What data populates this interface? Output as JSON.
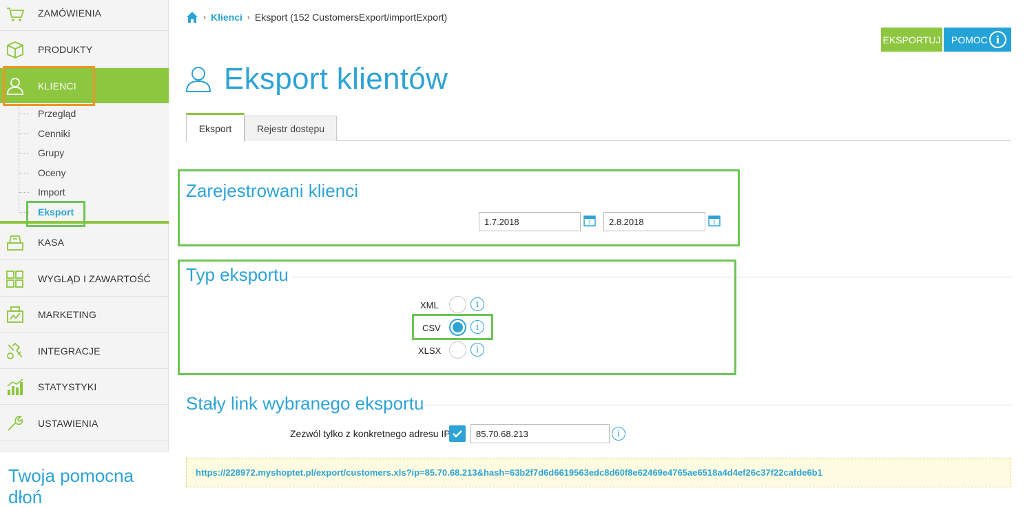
{
  "sidebar": {
    "nav": [
      {
        "label": "ZAMÓWIENIA",
        "icon": "cart-icon"
      },
      {
        "label": "PRODUKTY",
        "icon": "box-icon"
      },
      {
        "label": "KLIENCI",
        "icon": "user-icon"
      },
      {
        "label": "KASA",
        "icon": "cash-register-icon"
      },
      {
        "label": "WYGLĄD I ZAWARTOŚĆ",
        "icon": "layout-grid-icon"
      },
      {
        "label": "MARKETING",
        "icon": "marketing-icon"
      },
      {
        "label": "INTEGRACJE",
        "icon": "integration-icon"
      },
      {
        "label": "STATYSTYKI",
        "icon": "bar-chart-icon"
      },
      {
        "label": "USTAWIENIA",
        "icon": "wrench-icon"
      }
    ],
    "submenu": [
      "Przegląd",
      "Cenniki",
      "Grupy",
      "Oceny",
      "Import",
      "Eksport"
    ],
    "help_text": "Twoja pomocna dłoń"
  },
  "breadcrumb": {
    "parent": "Klienci",
    "current": "Eksport (152 CustomersExport/importExport)"
  },
  "actions": {
    "export_label": "EKSPORTUJ",
    "help_label": "POMOC"
  },
  "page": {
    "title": "Eksport klientów"
  },
  "tabs": {
    "export": "Eksport",
    "access_log": "Rejestr dostępu"
  },
  "registered": {
    "title": "Zarejestrowani klienci",
    "date_from": "1.7.2018",
    "date_to": "2.8.2018"
  },
  "export_type": {
    "title": "Typ eksportu",
    "options": [
      "XML",
      "CSV",
      "XLSX"
    ],
    "selected": "CSV"
  },
  "permanent_link": {
    "title": "Stały link wybranego eksportu",
    "ip_label": "Zezwól tylko z konkretnego adresu IP",
    "ip_value": "85.70.68.213",
    "ip_restriction_enabled": true,
    "url": "https://228972.myshoptet.pl/export/customers.xls?ip=85.70.68.213&hash=63b2f7d6d6619563edc8d60f8e62469e4765ae6518a4d4ef26c37f22cafde6b1"
  },
  "colors": {
    "accent_green": "#8dc63f",
    "accent_blue": "#2ea3d5",
    "highlight_orange": "#f0932b",
    "highlight_green": "#6cc554"
  }
}
